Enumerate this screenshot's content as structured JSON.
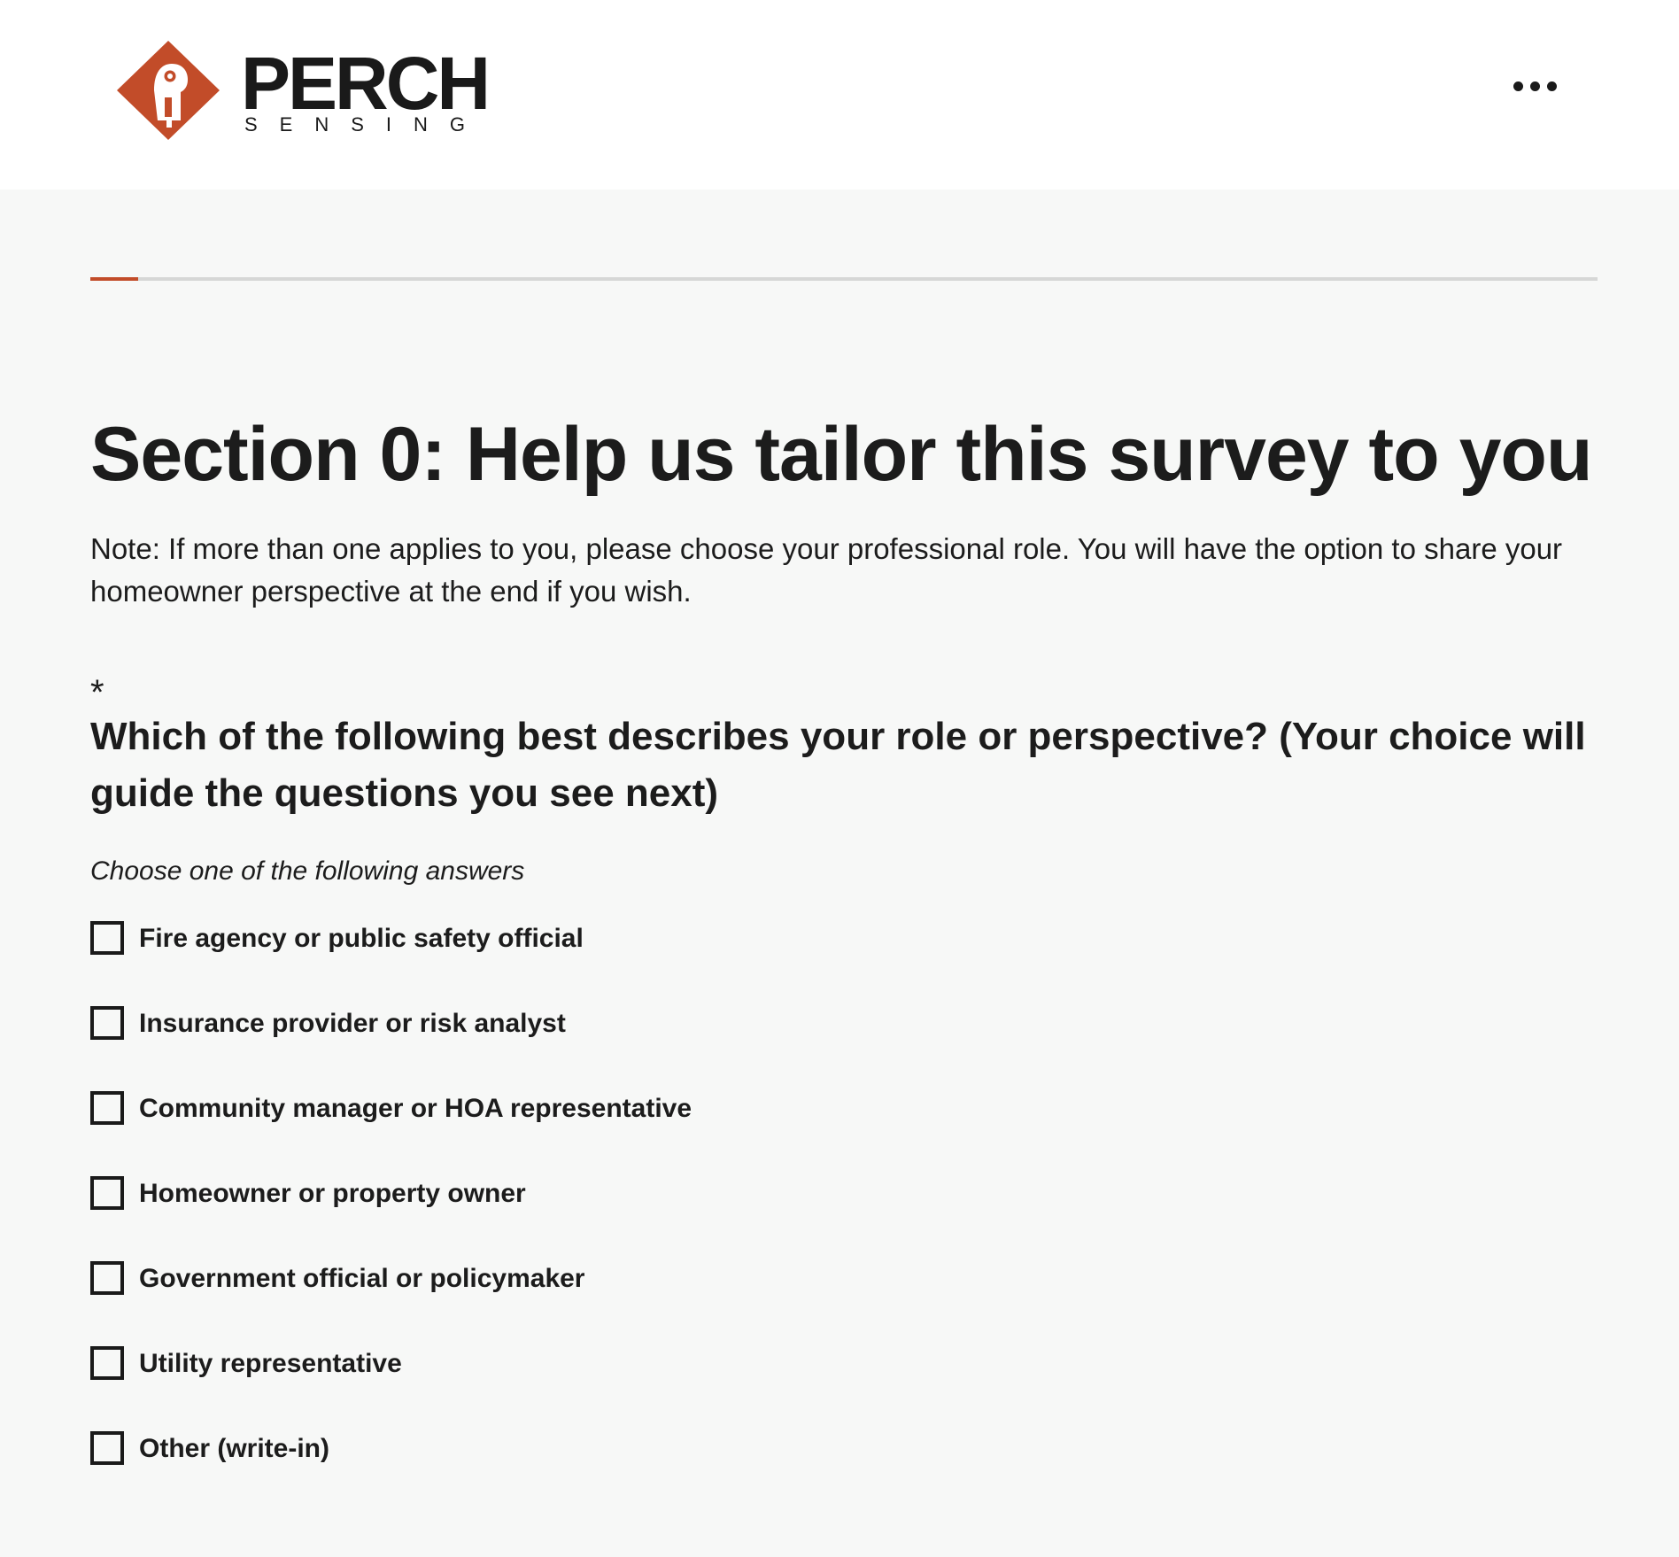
{
  "brand": {
    "name": "PERCH",
    "tagline": "SENSING",
    "accent_color": "#c24c29"
  },
  "header": {
    "menu_icon": "more-horizontal-icon"
  },
  "progress": {
    "fraction": 0.032
  },
  "section": {
    "title": "Section 0: Help us tailor this survey to you",
    "note": "Note: If more than one applies to you, please choose your professional role. You will have the option to share your homeowner perspective at the end if you wish."
  },
  "question": {
    "required_marker": "*",
    "text": "Which of the following best describes your role or perspective? (Your choice will guide the questions you see next)",
    "instruction": "Choose one of the following answers",
    "options": [
      {
        "label": "Fire agency or public safety official",
        "checked": false
      },
      {
        "label": "Insurance provider or risk analyst",
        "checked": false
      },
      {
        "label": "Community manager or HOA representative",
        "checked": false
      },
      {
        "label": "Homeowner or property owner",
        "checked": false
      },
      {
        "label": "Government official or policymaker",
        "checked": false
      },
      {
        "label": "Utility representative",
        "checked": false
      },
      {
        "label": "Other (write-in)",
        "checked": false
      }
    ]
  }
}
